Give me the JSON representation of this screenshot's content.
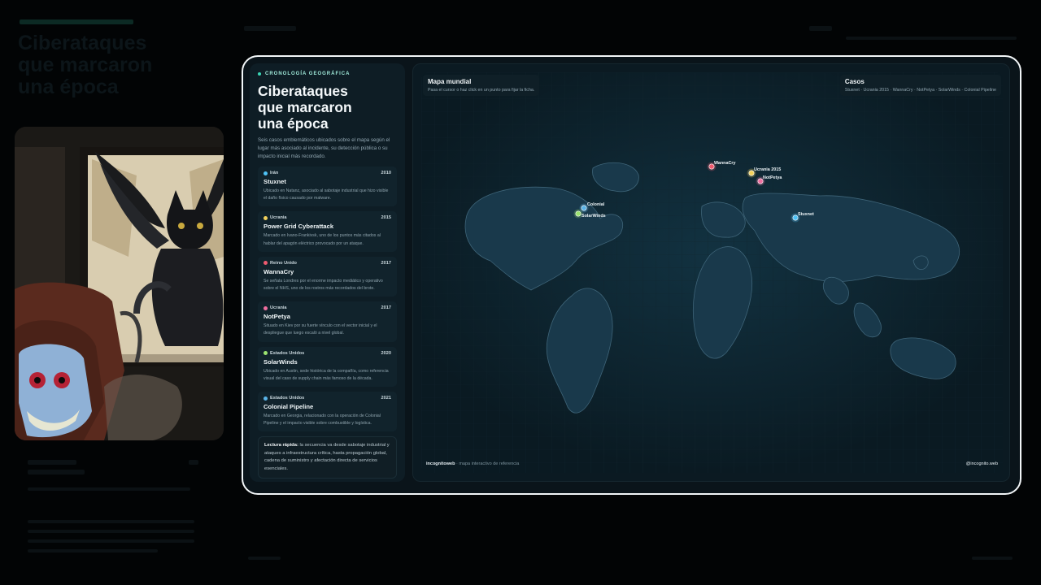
{
  "background_title": "Ciberataques\nque marcaron\nuna época",
  "panel": {
    "kicker": "CRONOLOGÍA GEOGRÁFICA",
    "title_line1": "Ciberataques",
    "title_line2": "que marcaron",
    "title_line3": "una época",
    "intro": "Seis casos emblemáticos ubicados sobre el mapa según el lugar más asociado al incidente, su detección pública o su impacto inicial más recordado.",
    "cards": [
      {
        "location": "Irán",
        "year": "2010",
        "name": "Stuxnet",
        "desc": "Ubicado en Natanz, asociado al sabotaje industrial que hizo visible el daño físico causado por malware.",
        "color": "#4fc3f7"
      },
      {
        "location": "Ucrania",
        "year": "2015",
        "name": "Power Grid Cyberattack",
        "desc": "Marcado en Ivano-Frankivsk, uno de los puntos más citados al hablar del apagón eléctrico provocado por un ataque.",
        "color": "#f2d15c"
      },
      {
        "location": "Reino Unido",
        "year": "2017",
        "name": "WannaCry",
        "desc": "Se señala Londres por el enorme impacto mediático y operativo sobre el NHS, uno de los rostros más recordados del brote.",
        "color": "#ee5a6f"
      },
      {
        "location": "Ucrania",
        "year": "2017",
        "name": "NotPetya",
        "desc": "Situado en Kiev por su fuerte vínculo con el vector inicial y el despliegue que luego escaló a nivel global.",
        "color": "#f06fa0"
      },
      {
        "location": "Estados Unidos",
        "year": "2020",
        "name": "SolarWinds",
        "desc": "Ubicado en Austin, sede histórica de la compañía, como referencia visual del caso de supply chain más famoso de la década.",
        "color": "#9be36f"
      },
      {
        "location": "Estados Unidos",
        "year": "2021",
        "name": "Colonial Pipeline",
        "desc": "Marcado en Georgia, relacionado con la operación de Colonial Pipeline y el impacto visible sobre combustible y logística.",
        "color": "#5ab4e8"
      }
    ],
    "summary_bold": "Lectura rápida:",
    "summary_text": " la secuencia va desde sabotaje industrial y ataques a infraestructura crítica, hasta propagación global, cadena de suministro y afectación directa de servicios esenciales."
  },
  "map": {
    "title": "Mapa mundial",
    "subtitle": "Pasa el cursor o haz click en un punto para fijar la ficha.",
    "cases_title": "Casos",
    "cases_list": "Stuxnet · Ucrania 2015 · WannaCry · NotPetya · SolarWinds · Colonial Pipeline",
    "markers": [
      {
        "label": "WannaCry",
        "color": "#ee5a6f"
      },
      {
        "label": "Ucrania 2015",
        "color": "#f2d15c"
      },
      {
        "label": "NotPetya",
        "color": "#f06fa0"
      },
      {
        "label": "Stuxnet",
        "color": "#4fc3f7"
      },
      {
        "label": "Colonial",
        "color": "#5ab4e8"
      },
      {
        "label": "SolarWinds",
        "color": "#9be36f"
      }
    ],
    "footer_brand": "incognitoweb",
    "footer_text": " · mapa interactivo de referencia",
    "footer_handle": "@incognito.web"
  }
}
